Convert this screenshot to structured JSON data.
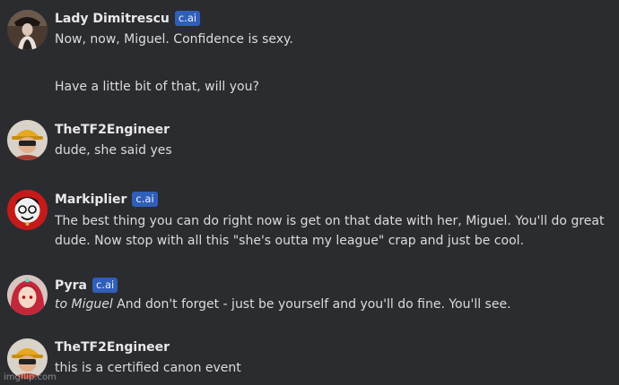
{
  "messages": [
    {
      "author": "Lady Dimitrescu",
      "badge": "c.ai",
      "avatar": "lady-dimitrescu-avatar",
      "lines": [
        "Now, now, Miguel. Confidence is sexy.",
        "Have a little bit of that, will you?"
      ]
    },
    {
      "author": "TheTF2Engineer",
      "avatar": "tf2-engineer-avatar",
      "lines": [
        "dude, she said yes"
      ]
    },
    {
      "author": "Markiplier",
      "badge": "c.ai",
      "avatar": "markiplier-avatar",
      "lines": [
        "The best thing you can do right now is get on that date with her, Miguel. You'll do great",
        "dude. Now stop with all this \"she's outta my league\" crap and just be cool."
      ]
    },
    {
      "author": "Pyra",
      "badge": "c.ai",
      "avatar": "pyra-avatar",
      "action": "to Miguel",
      "lines": [
        "And don't forget - just be yourself and you'll do fine. You'll see."
      ]
    },
    {
      "author": "TheTF2Engineer",
      "avatar": "tf2-engineer-avatar",
      "lines": [
        "this is a certified canon event"
      ]
    }
  ],
  "watermark": "imgflip.com"
}
